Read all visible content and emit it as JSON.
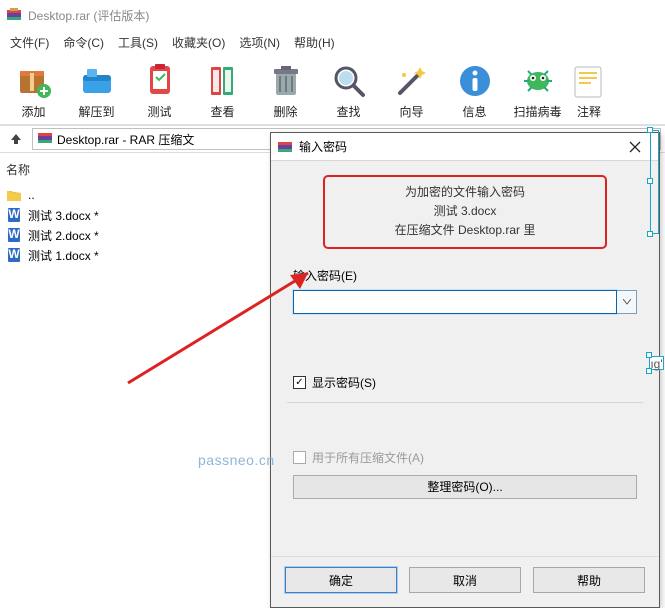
{
  "titlebar": {
    "title": "Desktop.rar (评估版本)"
  },
  "menu": {
    "file": "文件(F)",
    "cmd": "命令(C)",
    "tools": "工具(S)",
    "fav": "收藏夹(O)",
    "opts": "选项(N)",
    "help": "帮助(H)"
  },
  "toolbar": {
    "add": "添加",
    "extract": "解压到",
    "test": "测试",
    "view": "查看",
    "delete": "删除",
    "find": "查找",
    "wizard": "向导",
    "info": "信息",
    "scan": "扫描病毒",
    "comment": "注释"
  },
  "path": {
    "text": "Desktop.rar - RAR 压缩文"
  },
  "list": {
    "header": "名称",
    "up": "..",
    "items": [
      {
        "name": "测试 3.docx *"
      },
      {
        "name": "测试 2.docx *"
      },
      {
        "name": "测试 1.docx *"
      }
    ]
  },
  "dialog": {
    "title": "输入密码",
    "msg1": "为加密的文件输入密码",
    "msg2": "测试 3.docx",
    "msg3": "在压缩文件 Desktop.rar 里",
    "pw_label": "输入密码(E)",
    "show_pw": "显示密码(S)",
    "use_all": "用于所有压缩文件(A)",
    "organize": "整理密码(O)...",
    "ok": "确定",
    "cancel": "取消",
    "help": "帮助"
  },
  "watermark": "passneo.cn",
  "sel_label": "ıg'"
}
